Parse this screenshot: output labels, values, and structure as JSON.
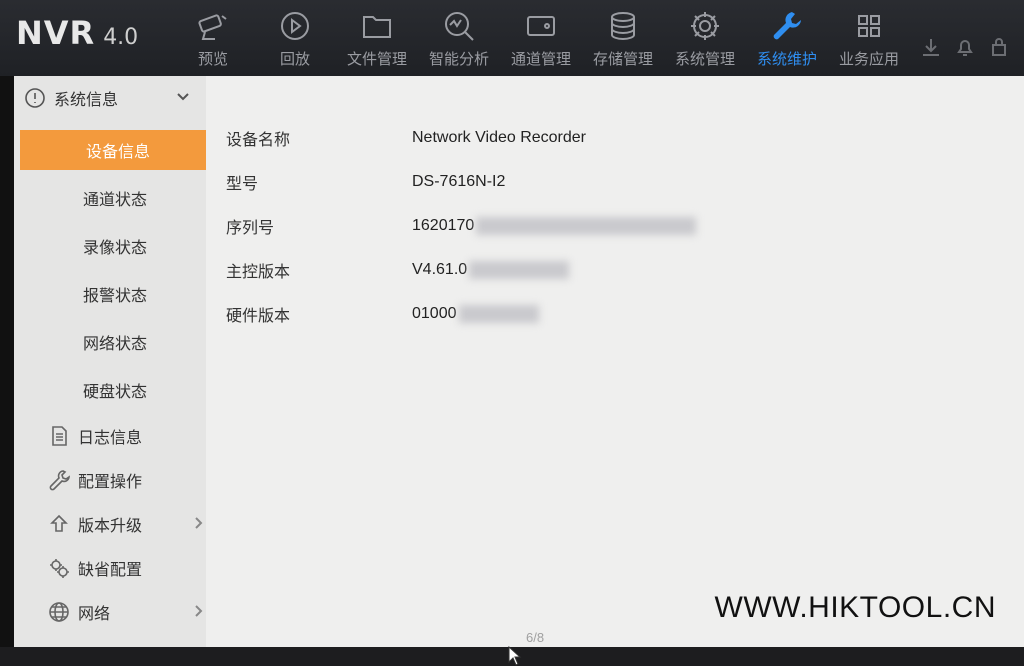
{
  "app": {
    "name": "NVR",
    "version": "4.0"
  },
  "nav": [
    {
      "label": "预览",
      "icon": "camera-icon"
    },
    {
      "label": "回放",
      "icon": "playback-icon"
    },
    {
      "label": "文件管理",
      "icon": "folder-icon"
    },
    {
      "label": "智能分析",
      "icon": "analytics-icon"
    },
    {
      "label": "通道管理",
      "icon": "channel-icon"
    },
    {
      "label": "存储管理",
      "icon": "storage-icon"
    },
    {
      "label": "系统管理",
      "icon": "gear-icon"
    },
    {
      "label": "系统维护",
      "icon": "wrench-icon",
      "active": true
    },
    {
      "label": "业务应用",
      "icon": "grid-icon"
    }
  ],
  "sidebar": {
    "group": {
      "label": "系统信息",
      "icon": "info-icon"
    },
    "subitems": [
      "设备信息",
      "通道状态",
      "录像状态",
      "报警状态",
      "网络状态",
      "硬盘状态"
    ],
    "active_sub": "设备信息",
    "items": [
      {
        "label": "日志信息",
        "icon": "document-icon"
      },
      {
        "label": "配置操作",
        "icon": "wrench-icon"
      },
      {
        "label": "版本升级",
        "icon": "upgrade-icon",
        "has_children": true
      },
      {
        "label": "缺省配置",
        "icon": "default-config-icon"
      },
      {
        "label": "网络",
        "icon": "globe-icon",
        "has_children": true
      }
    ]
  },
  "device_info": [
    {
      "key": "设备名称",
      "value": "Network Video Recorder"
    },
    {
      "key": "型号",
      "value": "DS-7616N-I2"
    },
    {
      "key": "序列号",
      "value": "1620170"
    },
    {
      "key": "主控版本",
      "value": "V4.61.0"
    },
    {
      "key": "硬件版本",
      "value": "01000"
    }
  ],
  "page_indicator": "6/8",
  "watermark": "WWW.HIKTOOL.CN",
  "colors": {
    "accent_orange": "#f39a3d",
    "active_blue": "#2f8ef0",
    "topbar": "#232529",
    "content_bg": "#efefee"
  }
}
